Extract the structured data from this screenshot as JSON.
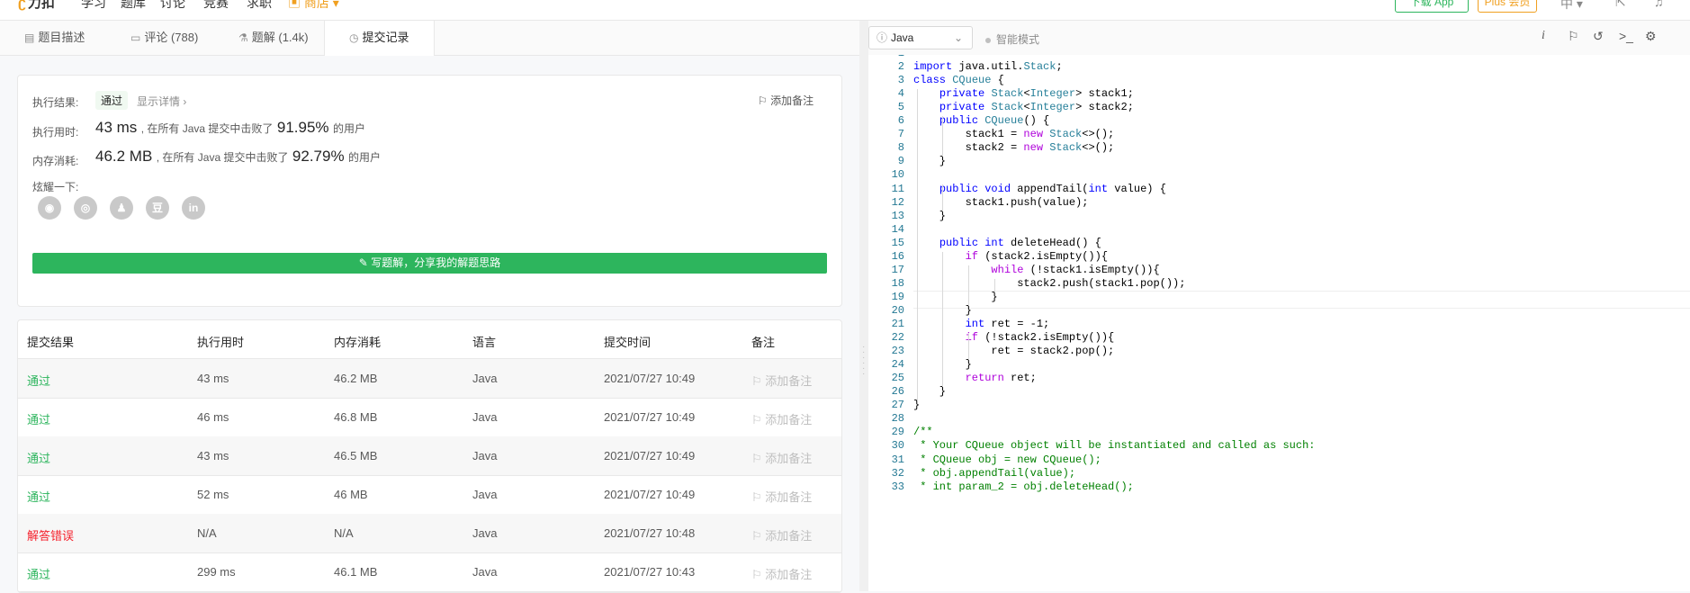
{
  "topnav": {
    "logo": "力扣",
    "items": [
      "学习",
      "题库",
      "讨论",
      "竞赛",
      "求职",
      "商店"
    ],
    "download_app": "下载 App",
    "plus": "Plus 会员"
  },
  "tabs": [
    {
      "label": "题目描述",
      "icon": "description-icon"
    },
    {
      "label": "评论 (788)",
      "icon": "comment-icon"
    },
    {
      "label": "题解 (1.4k)",
      "icon": "flask-icon"
    },
    {
      "label": "提交记录",
      "icon": "clock-icon"
    }
  ],
  "result": {
    "result_label": "执行结果:",
    "result_value": "通过",
    "show_details": "显示详情 ›",
    "add_note": "添加备注",
    "time_label": "执行用时:",
    "time_value": "43 ms",
    "time_text": ", 在所有 Java 提交中击败了",
    "time_pct": "91.95%",
    "users": "的用户",
    "mem_label": "内存消耗:",
    "mem_value": "46.2 MB",
    "mem_text": ", 在所有 Java 提交中击败了",
    "mem_pct": "92.79%",
    "show_off": "炫耀一下:",
    "share_icons": [
      "wechat-icon",
      "weibo-icon",
      "qq-icon",
      "douban-icon",
      "linkedin-icon"
    ],
    "write_solution": "写题解，分享我的解题思路"
  },
  "table": {
    "headers": [
      "提交结果",
      "执行用时",
      "内存消耗",
      "语言",
      "提交时间",
      "备注"
    ],
    "rows": [
      {
        "status": "通过",
        "time": "43 ms",
        "memory": "46.2 MB",
        "lang": "Java",
        "submitted": "2021/07/27 10:49",
        "note": "添加备注"
      },
      {
        "status": "通过",
        "time": "46 ms",
        "memory": "46.8 MB",
        "lang": "Java",
        "submitted": "2021/07/27 10:49",
        "note": "添加备注"
      },
      {
        "status": "通过",
        "time": "43 ms",
        "memory": "46.5 MB",
        "lang": "Java",
        "submitted": "2021/07/27 10:49",
        "note": "添加备注"
      },
      {
        "status": "通过",
        "time": "52 ms",
        "memory": "46 MB",
        "lang": "Java",
        "submitted": "2021/07/27 10:49",
        "note": "添加备注"
      },
      {
        "status": "解答错误",
        "time": "N/A",
        "memory": "N/A",
        "lang": "Java",
        "submitted": "2021/07/27 10:48",
        "note": "添加备注"
      },
      {
        "status": "通过",
        "time": "299 ms",
        "memory": "46.1 MB",
        "lang": "Java",
        "submitted": "2021/07/27 10:43",
        "note": "添加备注"
      }
    ]
  },
  "editor": {
    "language": "Java",
    "smart_mode": "智能模式",
    "active_line": 19,
    "lines": [
      "",
      "import java.util.Stack;",
      "class CQueue {",
      "    private Stack<Integer> stack1;",
      "    private Stack<Integer> stack2;",
      "    public CQueue() {",
      "        stack1 = new Stack<>();",
      "        stack2 = new Stack<>();",
      "    }",
      "",
      "    public void appendTail(int value) {",
      "        stack1.push(value);",
      "    }",
      "",
      "    public int deleteHead() {",
      "        if (stack2.isEmpty()){",
      "            while (!stack1.isEmpty()){",
      "                stack2.push(stack1.pop());",
      "            }",
      "        }",
      "        int ret = -1;",
      "        if (!stack2.isEmpty()){",
      "            ret = stack2.pop();",
      "        }",
      "        return ret;",
      "    }",
      "}",
      "",
      "/**",
      " * Your CQueue object will be instantiated and called as such:",
      " * CQueue obj = new CQueue();",
      " * obj.appendTail(value);",
      " * int param_2 = obj.deleteHead();"
    ]
  },
  "colors": {
    "accent_green": "#2db55d",
    "error_red": "#f5222d",
    "store_orange": "#f0a020"
  }
}
